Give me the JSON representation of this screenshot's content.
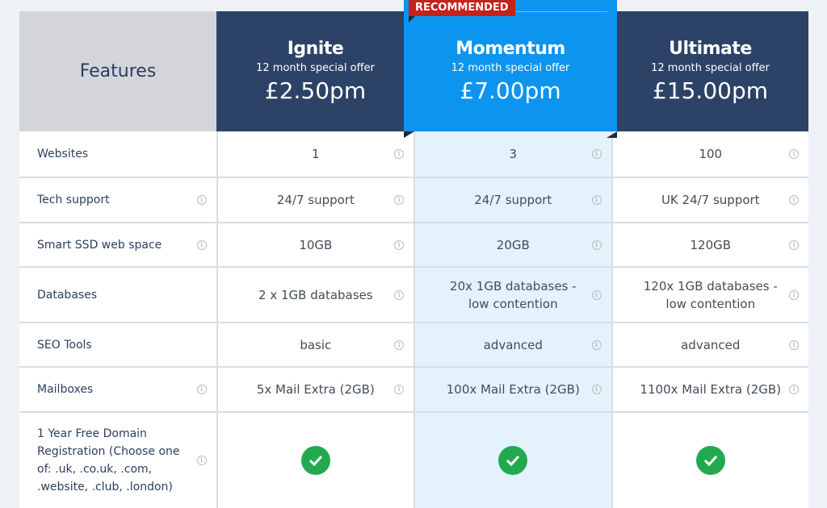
{
  "features_title": "Features",
  "recommended": "RECOMMENDED",
  "plans": [
    {
      "name": "Ignite",
      "offer": "12 month special offer",
      "price": "£2.50pm"
    },
    {
      "name": "Momentum",
      "offer": "12 month special offer",
      "price": "£7.00pm"
    },
    {
      "name": "Ultimate",
      "offer": "12 month special offer",
      "price": "£15.00pm"
    }
  ],
  "rows": [
    {
      "feature": "Websites",
      "values": [
        "1",
        "3",
        "100"
      ],
      "feature_info": false,
      "h": 56
    },
    {
      "feature": "Tech support",
      "values": [
        "24/7 support",
        "24/7 support",
        "UK 24/7 support"
      ],
      "feature_info": true,
      "h": 56
    },
    {
      "feature": "Smart SSD web space",
      "values": [
        "10GB",
        "20GB",
        "120GB"
      ],
      "feature_info": true,
      "h": 55
    },
    {
      "feature": "Databases",
      "values": [
        "2 x 1GB databases",
        "20x 1GB databases - low contention",
        "120x 1GB databases - low contention"
      ],
      "feature_info": false,
      "h": 69
    },
    {
      "feature": "SEO Tools",
      "values": [
        "basic",
        "advanced",
        "advanced"
      ],
      "feature_info": false,
      "h": 55
    },
    {
      "feature": "Mailboxes",
      "values": [
        "5x Mail Extra (2GB)",
        "100x Mail Extra (2GB)",
        "1100x Mail Extra (2GB)"
      ],
      "feature_info": true,
      "h": 56
    },
    {
      "feature": "1 Year Free Domain Registration (Choose one of: .uk, .co.uk, .com, .website, .club, .london)",
      "values": [
        "check",
        "check",
        "check"
      ],
      "feature_info": true,
      "h": 120
    }
  ],
  "colors": {
    "header": "#2c4266",
    "recommended": "#0c94ee",
    "badge": "#c4221a",
    "check": "#22a94f"
  }
}
